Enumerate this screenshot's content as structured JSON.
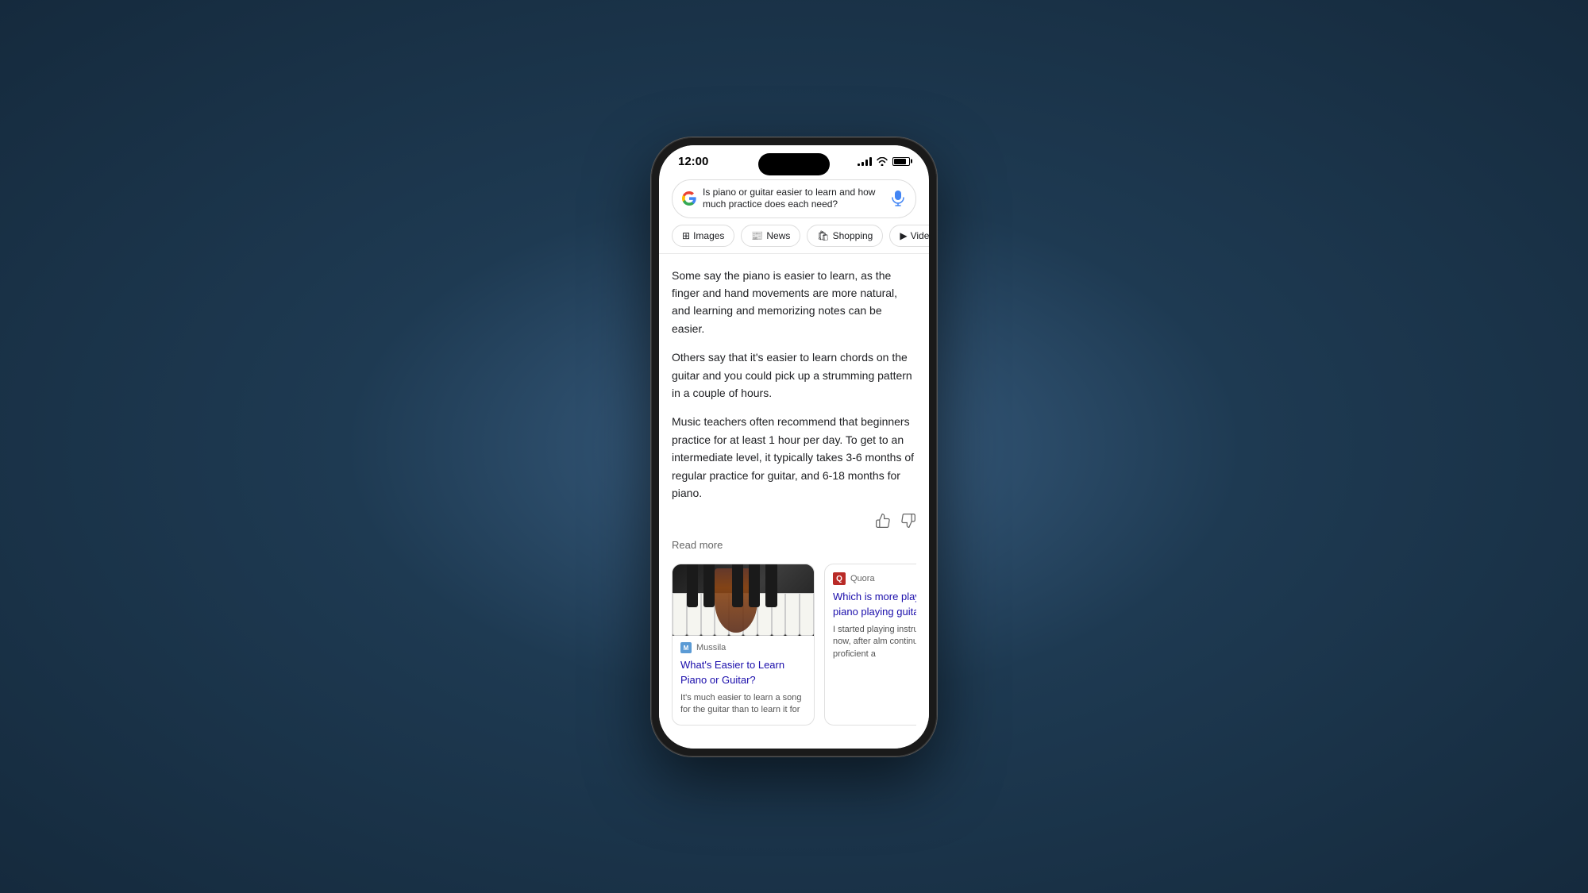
{
  "phone": {
    "status_bar": {
      "time": "12:00",
      "signal_bars": 4,
      "wifi": true,
      "battery_level": 85
    },
    "search": {
      "query": "Is piano or guitar easier to learn and how much practice does each need?",
      "mic_label": "microphone"
    },
    "filter_tabs": [
      {
        "id": "images",
        "label": "Images",
        "icon": "🖼"
      },
      {
        "id": "news",
        "label": "News",
        "icon": "📰"
      },
      {
        "id": "shopping",
        "label": "Shopping",
        "icon": "🛍"
      },
      {
        "id": "videos",
        "label": "Vide...",
        "icon": "▶"
      }
    ],
    "ai_answer": {
      "paragraphs": [
        "Some say the piano is easier to learn, as the finger and hand movements are more natural, and learning and memorizing notes can be easier.",
        "Others say that it's easier to learn chords on the guitar and you could pick up a strumming pattern in a couple of hours.",
        "Music teachers often recommend that beginners practice for at least 1 hour per day. To get to an intermediate level, it typically takes 3-6 months of regular practice for guitar, and 6-18 months for piano."
      ],
      "read_more_label": "Read more",
      "thumbs_up": "👍",
      "thumbs_down": "👎"
    },
    "result_cards": [
      {
        "id": "mussila",
        "source": "Mussila",
        "favicon_letter": "M",
        "favicon_color": "#5b9bd5",
        "title": "What's Easier to Learn Piano or Guitar?",
        "snippet": "It's much easier to learn a song for the guitar than to learn it for",
        "has_image": true
      },
      {
        "id": "quora",
        "source": "Quora",
        "favicon_letter": "Q",
        "favicon_color": "#b92b27",
        "title": "Which is more playing piano playing guitar",
        "snippet": "I started playing instruments th now, after alm continue to d proficient a",
        "has_image": false
      }
    ]
  }
}
